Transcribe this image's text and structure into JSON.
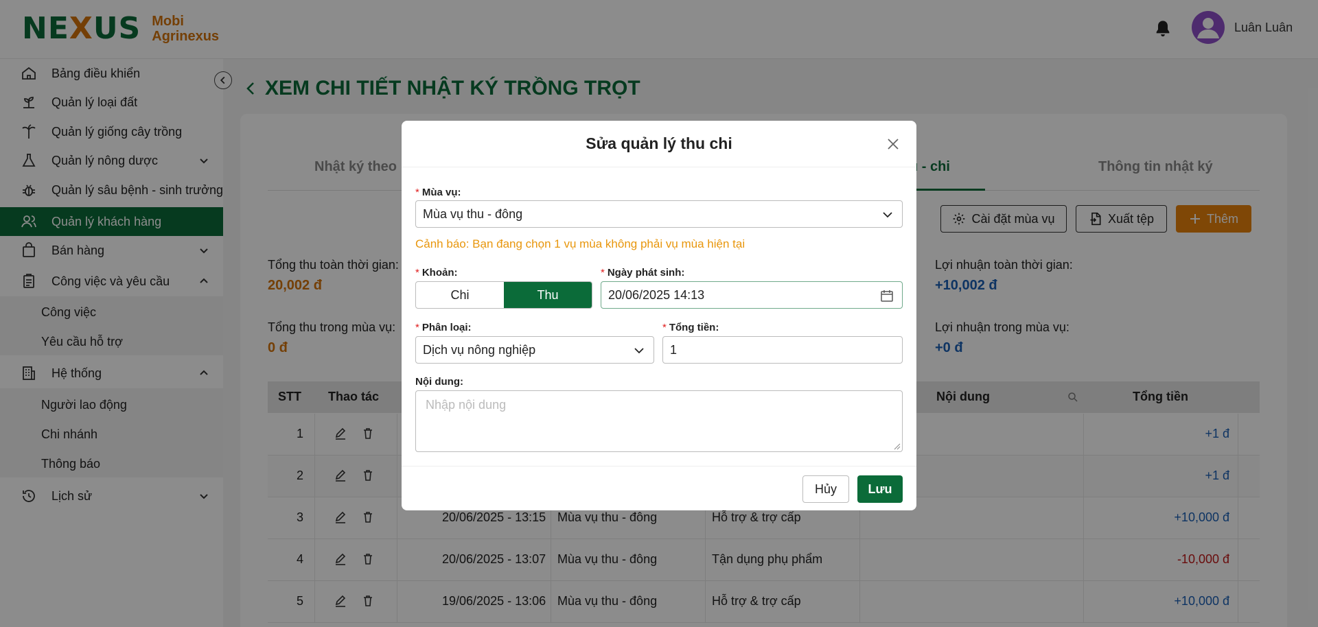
{
  "brand": {
    "mark_left": "NE",
    "mark_x": "X",
    "mark_right": "US",
    "name_line1": "Mobi",
    "name_line2": "Agrinexus"
  },
  "user": {
    "name": "Luân Luân"
  },
  "sidebar": {
    "items": [
      {
        "label": "Bảng điều khiển"
      },
      {
        "label": "Quản lý loại đất"
      },
      {
        "label": "Quản lý giống cây trồng"
      },
      {
        "label": "Quản lý nông dược"
      },
      {
        "label": "Quản lý sâu bệnh - sinh trưởng"
      },
      {
        "label": "Quản lý khách hàng"
      },
      {
        "label": "Bán hàng"
      },
      {
        "label": "Công việc và yêu cầu"
      },
      {
        "label": "Hệ thống"
      },
      {
        "label": "Lịch sử"
      }
    ],
    "work_sub": [
      {
        "label": "Công việc"
      },
      {
        "label": "Yêu cầu hỗ trợ"
      }
    ],
    "system_sub": [
      {
        "label": "Người lao động"
      },
      {
        "label": "Chi nhánh"
      },
      {
        "label": "Thông báo"
      }
    ]
  },
  "page": {
    "title": "XEM CHI TIẾT NHẬT KÝ TRỒNG TRỌT"
  },
  "tabs": [
    {
      "label": "Nhật ký theo"
    },
    {
      "label": "u - chi"
    },
    {
      "label": "Thông tin nhật ký"
    }
  ],
  "toolbar": {
    "season_settings": "Cài đặt mùa vụ",
    "export": "Xuất tệp",
    "add": "Thêm"
  },
  "stats": {
    "total_all_label": "Tổng thu toàn thời gian:",
    "total_all_value": "20,002 đ",
    "total_season_label": "Tổng thu trong mùa vụ:",
    "total_season_value": "0 đ",
    "profit_all_label": "Lợi nhuận toàn thời gian:",
    "profit_all_value": "+10,002 đ",
    "profit_season_label": "Lợi nhuận trong mùa vụ:",
    "profit_season_value": "+0 đ"
  },
  "table": {
    "headers": {
      "stt": "STT",
      "actions": "Thao tác",
      "content": "Nội dung",
      "total": "Tổng tiền"
    },
    "rows": [
      {
        "stt": "1",
        "date": "",
        "season": "",
        "category": "",
        "total": "+1 đ"
      },
      {
        "stt": "2",
        "date": "",
        "season": "",
        "category": "",
        "total": "+1 đ"
      },
      {
        "stt": "3",
        "date": "20/06/2025 - 13:15",
        "season": "Mùa vụ thu - đông",
        "category": "Hỗ trợ & trợ cấp",
        "total": "+10,000 đ"
      },
      {
        "stt": "4",
        "date": "20/06/2025 - 13:07",
        "season": "Mùa vụ thu - đông",
        "category": "Tận dụng phụ phẩm",
        "total": "-10,000 đ"
      },
      {
        "stt": "5",
        "date": "19/06/2025 - 13:06",
        "season": "Mùa vụ thu - đông",
        "category": "Hỗ trợ & trợ cấp",
        "total": "+10,000 đ"
      }
    ]
  },
  "modal": {
    "title": "Sửa quản lý thu chi",
    "season_label": "Mùa vụ:",
    "season_value": "Mùa vụ thu - đông",
    "warning": "Cảnh báo: Bạn đang chọn 1 vụ mùa không phải vụ mùa hiện tại",
    "type_label": "Khoản:",
    "type_options": [
      "Chi",
      "Thu"
    ],
    "date_label": "Ngày phát sinh:",
    "date_value": "20/06/2025 14:13",
    "category_label": "Phân loại:",
    "category_value": "Dịch vụ nông nghiệp",
    "amount_label": "Tổng tiền:",
    "amount_value": "1",
    "content_label": "Nội dung:",
    "content_placeholder": "Nhập nội dung",
    "cancel": "Hủy",
    "save": "Lưu"
  }
}
